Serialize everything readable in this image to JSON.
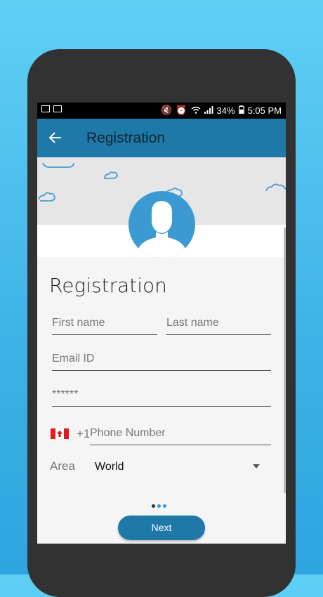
{
  "status_bar": {
    "battery": "34%",
    "time": "5:05 PM"
  },
  "app_bar": {
    "title": "Registration",
    "back_icon": "arrow-left-icon"
  },
  "form": {
    "title": "Registration",
    "first_name": {
      "placeholder": "First name",
      "value": ""
    },
    "last_name": {
      "placeholder": "Last name",
      "value": ""
    },
    "email": {
      "placeholder": "Email ID",
      "value": ""
    },
    "password": {
      "placeholder": "******",
      "value": ""
    },
    "phone": {
      "country_flag": "canada-flag-icon",
      "prefix": "+1",
      "placeholder": "Phone Number",
      "value": ""
    },
    "area": {
      "label": "Area",
      "selected": "World"
    }
  },
  "pager": {
    "count": 3,
    "active_index": 0
  },
  "next_button": {
    "label": "Next"
  },
  "colors": {
    "primary": "#1e78a8",
    "avatar": "#3b9ad1",
    "background": "#3db2e8"
  }
}
